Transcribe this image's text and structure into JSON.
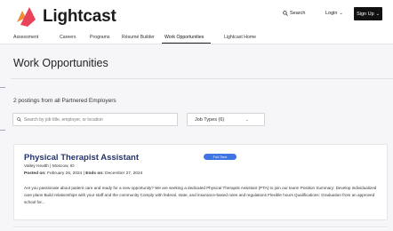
{
  "brand": {
    "name": "Lightcast"
  },
  "header": {
    "search_label": "Search",
    "login_label": "Login",
    "signup_label": "Sign Up"
  },
  "nav": {
    "items": [
      "Assessment",
      "Careers",
      "Programs",
      "Résumé Builder",
      "Work Opportunities",
      "Lightcast Home"
    ],
    "active": "Work Opportunities"
  },
  "page": {
    "title": "Work Opportunities"
  },
  "results": {
    "summary": "2 postings from all Partnered Employers"
  },
  "search": {
    "placeholder": "Search by job title, employer, or location"
  },
  "filters": {
    "job_types_label": "Job Types (6)"
  },
  "job": {
    "title": "Physical Therapist Assistant",
    "badge": "Full-Time",
    "employer": "Valley Health",
    "location": "Moscow, ID",
    "posted_label": "Posted on:",
    "posted_date": "February 26, 2024",
    "ends_label": "Ends on:",
    "ends_date": "December 27, 2024",
    "description": "Are you passionate about patient care and ready for a new opportunity? We are seeking a dedicated Physical Therapist Assistant (PTA) to join our team! Position Summary: Develop individualized care plans Build relationships with your staff and the community Comply with federal, state, and insurance-based rules and regulations Flexible hours Qualifications: Graduation from an approved school for..."
  },
  "colors": {
    "brand_red": "#e8435a",
    "brand_orange": "#f08c3a",
    "job_title": "#24346b",
    "badge": "#3f74e4",
    "signup_bg": "#111111"
  }
}
